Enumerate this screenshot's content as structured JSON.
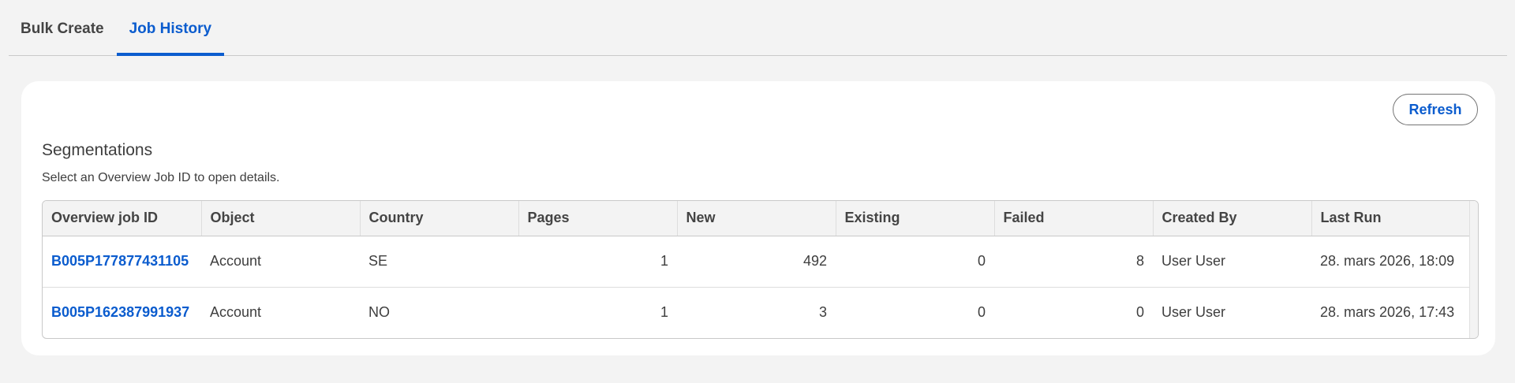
{
  "tabs": [
    {
      "label": "Bulk Create",
      "active": false
    },
    {
      "label": "Job History",
      "active": true
    }
  ],
  "card": {
    "refresh_label": "Refresh",
    "section_title": "Segmentations",
    "section_help": "Select an Overview Job ID to open details."
  },
  "table": {
    "columns": [
      "Overview job ID",
      "Object",
      "Country",
      "Pages",
      "New",
      "Existing",
      "Failed",
      "Created By",
      "Last Run"
    ],
    "rows": [
      {
        "job_id": "B005P177877431105",
        "object": "Account",
        "country": "SE",
        "pages": "1",
        "new": "492",
        "existing": "0",
        "failed": "8",
        "created_by": "User User",
        "last_run": "28. mars 2026, 18:09"
      },
      {
        "job_id": "B005P162387991937",
        "object": "Account",
        "country": "NO",
        "pages": "1",
        "new": "3",
        "existing": "0",
        "failed": "0",
        "created_by": "User User",
        "last_run": "28. mars 2026, 17:43"
      }
    ]
  },
  "colors": {
    "accent": "#0b5cce",
    "page_background": "#f3f3f3",
    "card_background": "#ffffff"
  }
}
